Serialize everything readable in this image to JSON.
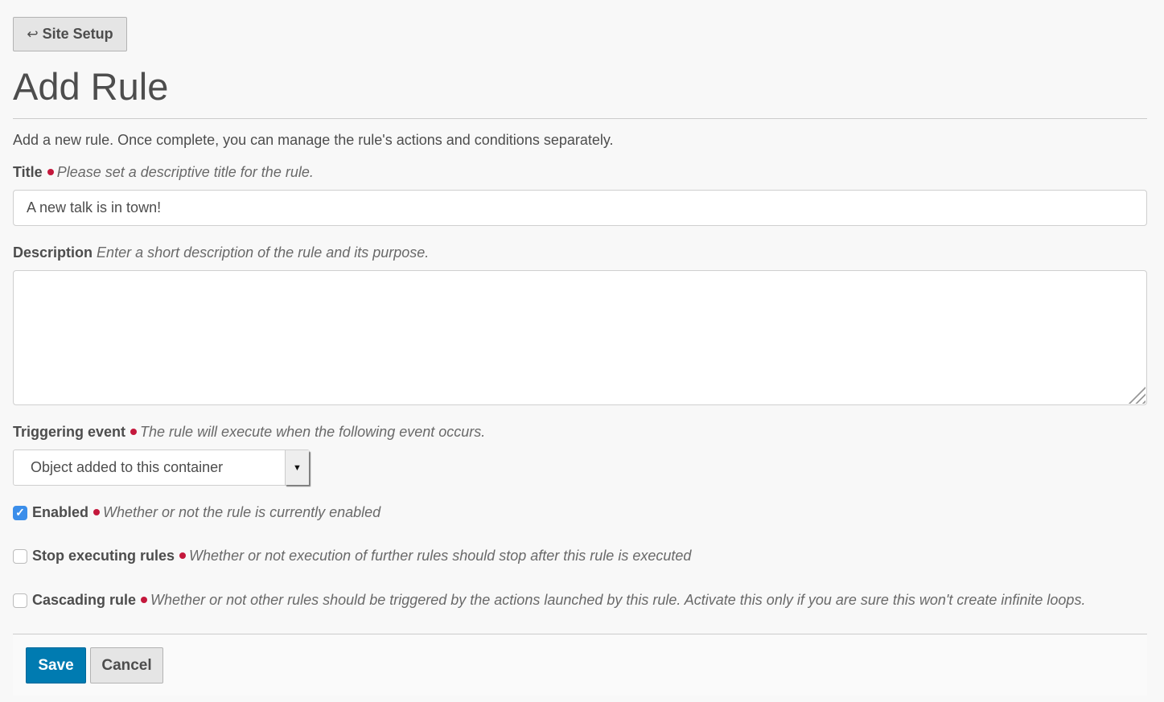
{
  "back_button": {
    "icon": "return-arrow-icon",
    "glyph": "↩",
    "label": "Site Setup"
  },
  "page_title": "Add Rule",
  "intro": "Add a new rule. Once complete, you can manage the rule's actions and conditions separately.",
  "fields": {
    "title": {
      "label": "Title",
      "required": true,
      "help": "Please set a descriptive title for the rule.",
      "value": "A new talk is in town!"
    },
    "description": {
      "label": "Description",
      "required": false,
      "help": "Enter a short description of the rule and its purpose.",
      "value": ""
    },
    "event": {
      "label": "Triggering event",
      "required": true,
      "help": "The rule will execute when the following event occurs.",
      "selected": "Object added to this container",
      "arrow": "▼"
    },
    "enabled": {
      "label": "Enabled",
      "required": true,
      "help": "Whether or not the rule is currently enabled",
      "checked": true,
      "check_glyph": "✓"
    },
    "stop": {
      "label": "Stop executing rules",
      "required": true,
      "help": "Whether or not execution of further rules should stop after this rule is executed",
      "checked": false
    },
    "cascading": {
      "label": "Cascading rule",
      "required": true,
      "help": "Whether or not other rules should be triggered by the actions launched by this rule. Activate this only if you are sure this won't create infinite loops.",
      "checked": false
    }
  },
  "buttons": {
    "save": "Save",
    "cancel": "Cancel"
  },
  "colors": {
    "required_dot": "#c4183c",
    "primary": "#007bb1",
    "checkbox": "#3b8eea"
  }
}
